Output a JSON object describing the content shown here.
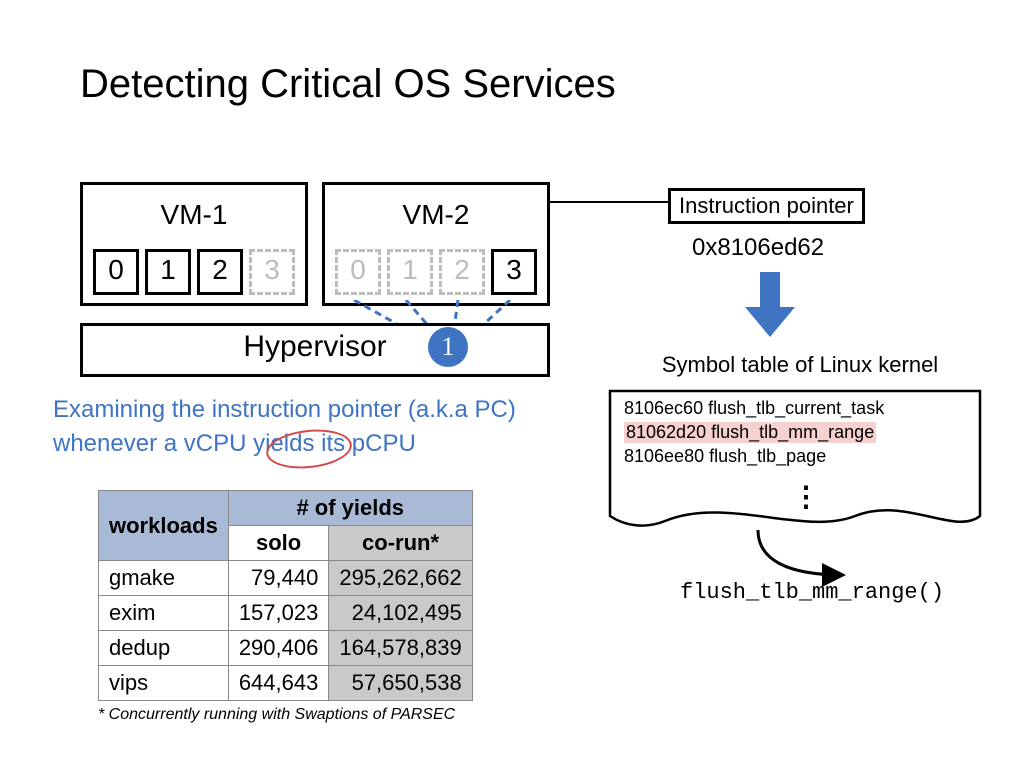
{
  "title": "Detecting Critical OS Services",
  "vm1": {
    "label": "VM-1",
    "cpus": [
      "0",
      "1",
      "2",
      "3"
    ],
    "dashed_idx": [
      3
    ]
  },
  "vm2": {
    "label": "VM-2",
    "cpus": [
      "0",
      "1",
      "2",
      "3"
    ],
    "dashed_idx": [
      0,
      1,
      2
    ]
  },
  "hypervisor": "Hypervisor",
  "pcpu_circle": "1",
  "caption_line1": "Examining the instruction pointer (a.k.a PC)",
  "caption_line2": "whenever a vCPU yields its pCPU",
  "table": {
    "head_workloads": "workloads",
    "head_yields": "# of yields",
    "head_solo": "solo",
    "head_corun": "co-run*",
    "rows": [
      {
        "w": "gmake",
        "solo": "79,440",
        "co": "295,262,662"
      },
      {
        "w": "exim",
        "solo": "157,023",
        "co": "24,102,495"
      },
      {
        "w": "dedup",
        "solo": "290,406",
        "co": "164,578,839"
      },
      {
        "w": "vips",
        "solo": "644,643",
        "co": "57,650,538"
      }
    ]
  },
  "footnote": "* Concurrently running with Swaptions of PARSEC",
  "ipointer_label": "Instruction pointer",
  "ipointer_value": "0x8106ed62",
  "symtable_label": "Symbol table of Linux kernel",
  "symbols": [
    {
      "addr": "8106ec60",
      "name": "flush_tlb_current_task",
      "hl": false
    },
    {
      "addr": "81062d20",
      "name": "flush_tlb_mm_range",
      "hl": true
    },
    {
      "addr": "8106ee80",
      "name": "flush_tlb_page",
      "hl": false
    }
  ],
  "resolved_fn": "flush_tlb_mm_range()"
}
